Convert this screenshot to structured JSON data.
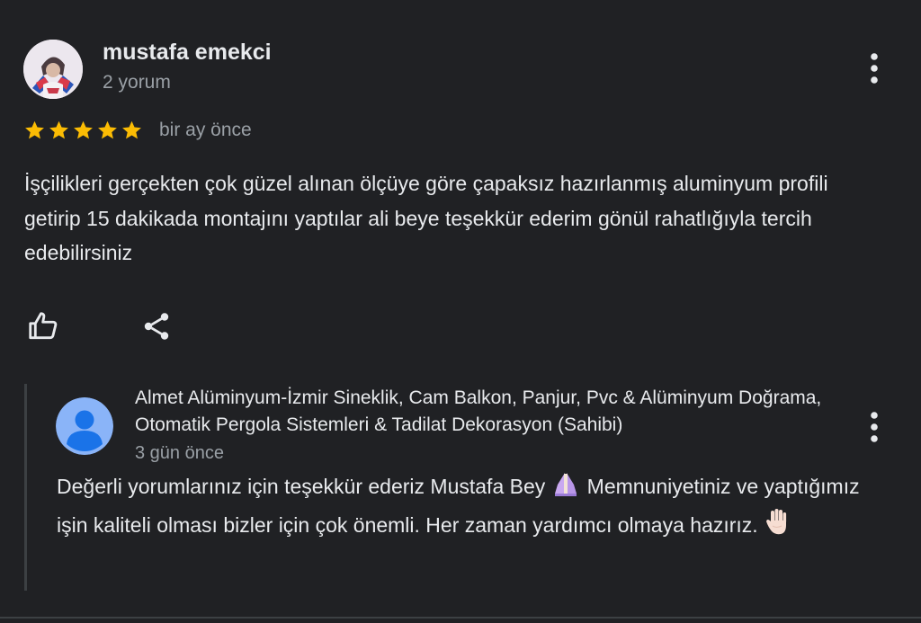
{
  "review": {
    "reviewer_name": "mustafa emekci",
    "review_count": "2 yorum",
    "rating": 5,
    "rating_max": 5,
    "date": "bir ay önce",
    "text": "İşçilikleri gerçekten çok güzel alınan ölçüye göre çapaksız hazırlanmış aluminyum profili getirip 15 dakikada montajını yaptılar ali beye teşekkür ederim gönül rahatlığıyla tercih edebilirsiniz",
    "star_color": "#fbbc04"
  },
  "actions": {
    "like_icon": "thumb-up-icon",
    "share_icon": "share-icon"
  },
  "owner_reply": {
    "owner_name": "Almet Alüminyum-İzmir Sineklik, Cam Balkon, Panjur, Pvc & Alüminyum Doğrama, Otomatik Pergola Sistemleri & Tadilat Dekorasyon (Sahibi)",
    "date": "3 gün önce",
    "text_part1": "Değerli yorumlarınız için teşekkür ederiz Mustafa Bey",
    "text_part2": "Memnuniyetiniz ve yaptığımız işin kaliteli olması bizler için çok önemli. Her zaman yardımcı olmaya hazırız.",
    "emoji1": "folded-hands-emoji",
    "emoji2": "raised-hand-emoji",
    "avatar_color": "#8ab4f8"
  },
  "colors": {
    "background": "#202124",
    "primary_text": "#e8eaed",
    "secondary_text": "#9aa0a6"
  }
}
